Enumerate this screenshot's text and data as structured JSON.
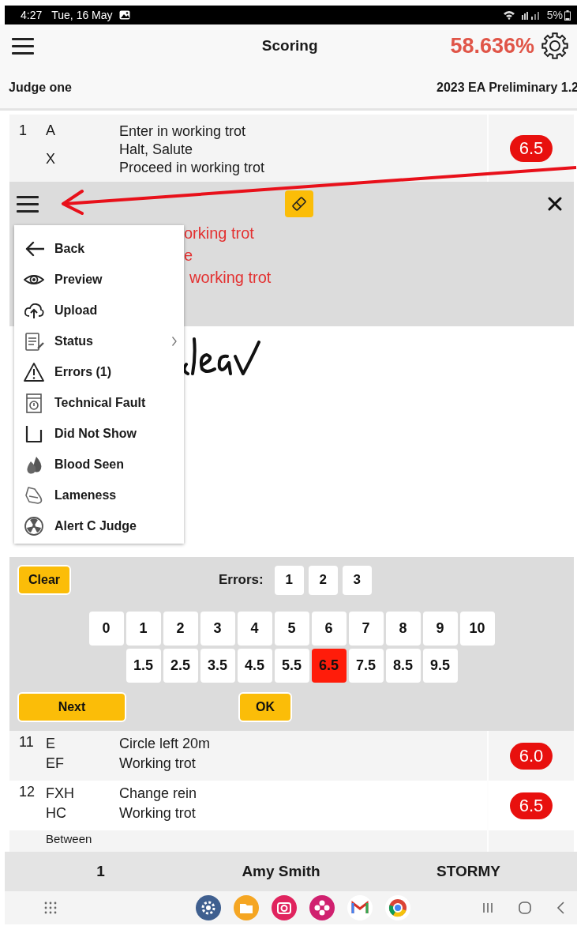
{
  "status_bar": {
    "time": "4:27",
    "date": "Tue, 16 May",
    "battery": "5%"
  },
  "app_bar": {
    "title": "Scoring",
    "percentage": "58.636%"
  },
  "info": {
    "judge": "Judge one",
    "test": "2023 EA Preliminary 1.2"
  },
  "movements_above": [
    {
      "number": "1",
      "markers": [
        "A",
        "X"
      ],
      "descriptions": [
        "Enter in working trot",
        "Halt, Salute",
        "Proceed in working trot"
      ],
      "score": "6.5"
    }
  ],
  "editor": {
    "fragments": [
      "orking trot",
      "e",
      "working trot"
    ]
  },
  "menu": [
    {
      "kind": "back",
      "label": "Back",
      "submenu": false
    },
    {
      "kind": "preview",
      "label": "Preview",
      "submenu": false
    },
    {
      "kind": "upload",
      "label": "Upload",
      "submenu": false
    },
    {
      "kind": "status",
      "label": "Status",
      "submenu": true
    },
    {
      "kind": "errors",
      "label": "Errors (1)",
      "submenu": false
    },
    {
      "kind": "fault",
      "label": "Technical Fault",
      "submenu": false
    },
    {
      "kind": "noshow",
      "label": "Did Not Show",
      "submenu": false
    },
    {
      "kind": "blood",
      "label": "Blood Seen",
      "submenu": false
    },
    {
      "kind": "lameness",
      "label": "Lameness",
      "submenu": false
    },
    {
      "kind": "alert",
      "label": "Alert C Judge",
      "submenu": false
    }
  ],
  "scoring": {
    "clear": "Clear",
    "errors_label": "Errors:",
    "errors": [
      {
        "label": "1",
        "selected": false
      },
      {
        "label": "2",
        "selected": false
      },
      {
        "label": "3",
        "selected": false
      }
    ],
    "whole": [
      {
        "label": "0",
        "selected": false
      },
      {
        "label": "1",
        "selected": false
      },
      {
        "label": "2",
        "selected": false
      },
      {
        "label": "3",
        "selected": false
      },
      {
        "label": "4",
        "selected": false
      },
      {
        "label": "5",
        "selected": false
      },
      {
        "label": "6",
        "selected": false
      },
      {
        "label": "7",
        "selected": false
      },
      {
        "label": "8",
        "selected": false
      },
      {
        "label": "9",
        "selected": false
      },
      {
        "label": "10",
        "selected": false
      }
    ],
    "half": [
      {
        "label": "1.5",
        "selected": false
      },
      {
        "label": "2.5",
        "selected": false
      },
      {
        "label": "3.5",
        "selected": false
      },
      {
        "label": "4.5",
        "selected": false
      },
      {
        "label": "5.5",
        "selected": false
      },
      {
        "label": "6.5",
        "selected": true
      },
      {
        "label": "7.5",
        "selected": false
      },
      {
        "label": "8.5",
        "selected": false
      },
      {
        "label": "9.5",
        "selected": false
      }
    ],
    "next": "Next",
    "ok": "OK"
  },
  "movements_below": [
    {
      "number": "11",
      "markers": [
        "E",
        "EF"
      ],
      "descriptions": [
        "Circle left 20m",
        "Working trot"
      ],
      "score": "6.0"
    },
    {
      "number": "12",
      "markers": [
        "FXH",
        "HC"
      ],
      "descriptions": [
        "Change rein",
        "Working trot"
      ],
      "score": "6.5"
    },
    {
      "markers": [
        "Between"
      ]
    }
  ],
  "footer": {
    "number": "1",
    "rider": "Amy Smith",
    "horse": "STORMY"
  }
}
